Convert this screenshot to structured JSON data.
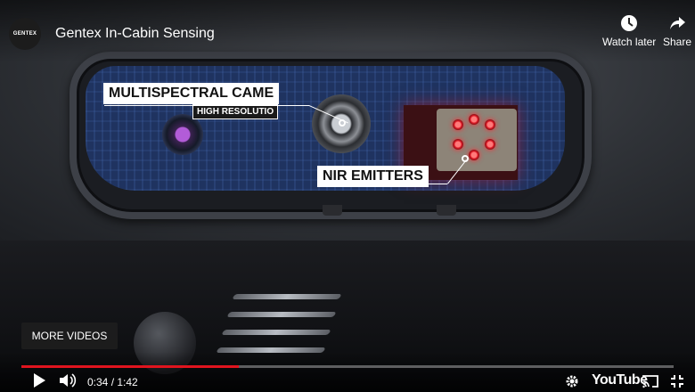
{
  "player": {
    "channel_logo_text": "GENTEX",
    "title": "Gentex In-Cabin Sensing",
    "watch_later_label": "Watch later",
    "share_label": "Share",
    "more_videos_label": "MORE VIDEOS",
    "time_display": "0:34 / 1:42",
    "progress": 0.333,
    "logo_text": "YouTube"
  },
  "overlay": {
    "camera_label": "MULTISPECTRAL CAME",
    "camera_sub_label": "HIGH RESOLUTIO",
    "emitters_label": "NIR EMITTERS"
  },
  "colors": {
    "progress_red": "#e0141e",
    "emitter_red": "#e01c28",
    "pcb_blue": "#1f3360"
  },
  "icons": [
    "clock-icon",
    "share-arrow-icon",
    "play-icon",
    "volume-icon",
    "gear-icon",
    "cast-icon",
    "exit-fullscreen-icon"
  ]
}
